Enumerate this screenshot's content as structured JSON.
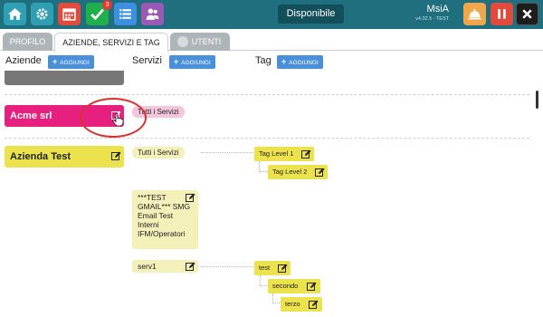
{
  "topbar": {
    "notification_count": "3",
    "status": "Disponibile",
    "app_name": "MsiA",
    "app_version": "v4.32.5 - TEST",
    "icons": [
      "home-icon",
      "gear-icon",
      "calendar-icon",
      "check-icon",
      "list-icon",
      "users-icon",
      "concierge-bell-icon",
      "pause-icon",
      "close-icon"
    ]
  },
  "tabs": {
    "profilo": "PROFILO",
    "aziende": "AZIENDE, SERVIZI E TAG",
    "utenti": "UTENTI"
  },
  "columns": {
    "aziende": "Aziende",
    "servizi": "Servizi",
    "tag": "Tag",
    "add_label": "AGGIUNGI"
  },
  "aziende": [
    {
      "name": "Acme srl",
      "color": "#e7207f"
    },
    {
      "name": "Azienda Test",
      "color": "#ece24d"
    }
  ],
  "servizi": {
    "acme": [
      "Tutti i Servizi"
    ],
    "azienda_test": [
      "Tutti i Servizi",
      "***TEST GMAIL*** SMG Email Test Interni IFM/Operatori",
      "serv1"
    ]
  },
  "tags": {
    "tutti": [
      "Tag Level 1",
      "Tag Level 2"
    ],
    "serv1": [
      "test",
      "secondo",
      "terzo"
    ]
  }
}
